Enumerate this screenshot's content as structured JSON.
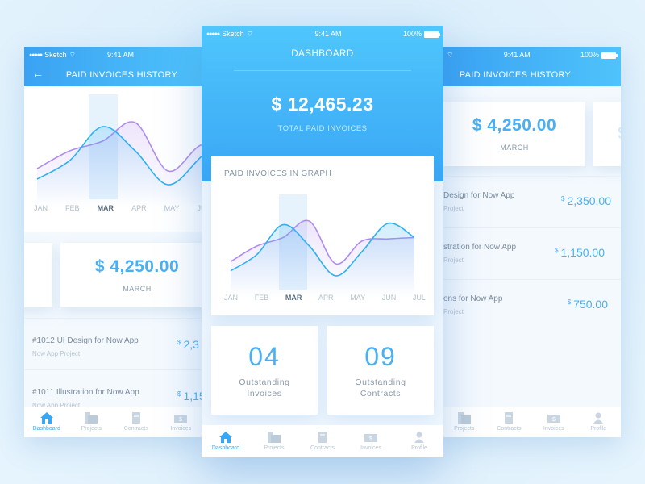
{
  "status_bar": {
    "carrier": "Sketch",
    "time": "9:41 AM",
    "battery": "100%"
  },
  "left_screen": {
    "title": "PAID INVOICES HISTORY",
    "months": [
      "JAN",
      "FEB",
      "MAR",
      "APR",
      "MAY",
      "JUN"
    ],
    "active_month": "MAR",
    "card": {
      "amount": "$ 4,250.00",
      "label": "MARCH"
    },
    "invoices": [
      {
        "title": "#1012 UI Design for Now App",
        "project": "Now App Project",
        "amount": "2,3"
      },
      {
        "title": "#1011 Illustration for Now App",
        "project": "Now App Project",
        "amount": "1,15"
      }
    ],
    "tabs": [
      "Dashboard",
      "Projects",
      "Contracts",
      "Invoices"
    ]
  },
  "center_screen": {
    "title": "DASHBOARD",
    "total_amount": "$ 12,465.23",
    "total_label": "TOTAL PAID INVOICES",
    "graph_title": "PAID INVOICES IN GRAPH",
    "stats": [
      {
        "value": "04",
        "label_line1": "Outstanding",
        "label_line2": "Invoices"
      },
      {
        "value": "09",
        "label_line1": "Outstanding",
        "label_line2": "Contracts"
      }
    ],
    "tabs": [
      "Dashboard",
      "Projects",
      "Contracts",
      "Invoices",
      "Profile"
    ],
    "active_tab": "Dashboard"
  },
  "right_screen": {
    "title": "PAID INVOICES HISTORY",
    "card": {
      "amount": "$ 4,250.00",
      "label": "MARCH"
    },
    "next_card_peek": "$",
    "invoices": [
      {
        "title": "Design for Now App",
        "project": "Project",
        "amount": "2,350.00"
      },
      {
        "title": "stration for Now App",
        "project": "Project",
        "amount": "1,150.00"
      },
      {
        "title": "ons for Now App",
        "project": "Project",
        "amount": "750.00"
      }
    ],
    "tabs": [
      "Projects",
      "Contracts",
      "Invoices",
      "Profile"
    ]
  },
  "currency_symbol": "$",
  "colors": {
    "accent": "#4ab0f3",
    "header_start": "#4fc6fc",
    "header_end": "#3aa7f5",
    "series_blue": "#2fb0f0",
    "series_purple": "#b08cf0"
  },
  "chart_data": {
    "type": "line",
    "title": "PAID INVOICES IN GRAPH",
    "categories": [
      "JAN",
      "FEB",
      "MAR",
      "APR",
      "MAY",
      "JUN",
      "JUL"
    ],
    "highlight": "MAR",
    "series": [
      {
        "name": "blue",
        "values": [
          15,
          38,
          80,
          50,
          8,
          42,
          82,
          62
        ]
      },
      {
        "name": "purple",
        "values": [
          28,
          50,
          62,
          85,
          25,
          57,
          60,
          62
        ]
      }
    ],
    "ylim": [
      0,
      100
    ],
    "grid": false
  }
}
